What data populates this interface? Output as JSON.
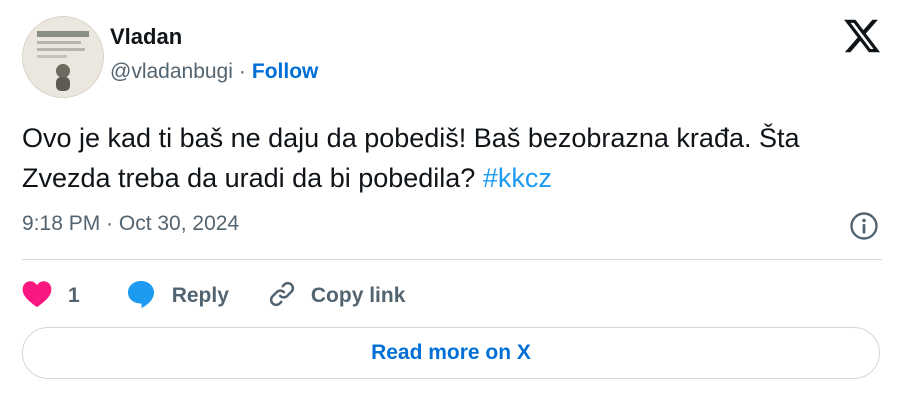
{
  "author": {
    "name": "Vladan",
    "handle": "@vladanbugi",
    "separator": "·",
    "follow_label": "Follow"
  },
  "tweet": {
    "text": "Ovo je kad ti baš ne daju da pobediš! Baš bezobrazna krađa. Šta Zvezda treba da uradi da bi pobedila?",
    "hashtag": "#kkcz",
    "timestamp": "9:18 PM · Oct 30, 2024"
  },
  "actions": {
    "like_count": "1",
    "reply_label": "Reply",
    "copy_link_label": "Copy link"
  },
  "footer": {
    "read_more_label": "Read more on X"
  },
  "icons": {
    "brand": "x-logo-icon",
    "info": "info-icon",
    "like": "heart-icon",
    "reply": "speech-bubble-icon",
    "copy_link": "link-icon"
  },
  "colors": {
    "link_blue": "#006fd6",
    "hashtag_blue": "#1d9bf0",
    "heart_pink": "#f91880",
    "reply_blue": "#1d9bf0",
    "muted_text": "#536471",
    "divider": "#cfd9de"
  }
}
